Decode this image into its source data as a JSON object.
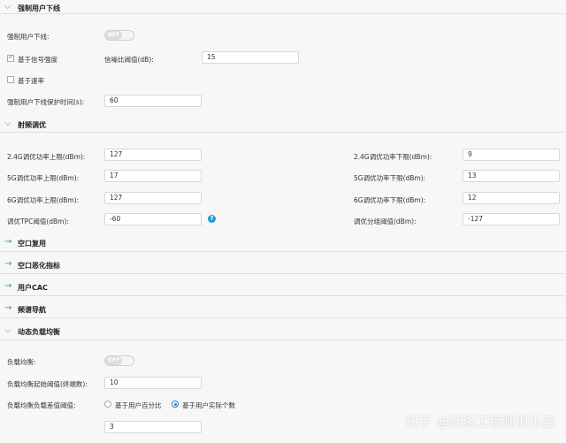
{
  "sections": {
    "forced_offline": "强制用户下线",
    "rf_tuning": "射频调优",
    "air_reuse": "空口复用",
    "air_degrade": "空口恶化指标",
    "user_cac": "用户CAC",
    "band_nav": "频谱导航",
    "dyn_lb": "动态负载均衡"
  },
  "forced_offline": {
    "enable_label": "强制用户下线:",
    "toggle_text": "OFF",
    "signal_check_label": "基于信号强度",
    "snr_label": "信噪比阈值(dB):",
    "snr_value": "15",
    "rate_check_label": "基于速率",
    "protect_label": "强制用户下线保护时间(s):",
    "protect_value": "60"
  },
  "rf": {
    "p24_up_label": "2.4G调优功率上限(dBm):",
    "p24_up_value": "127",
    "p24_down_label": "2.4G调优功率下限(dBm):",
    "p24_down_value": "9",
    "p5_up_label": "5G调优功率上限(dBm):",
    "p5_up_value": "17",
    "p5_down_label": "5G调优功率下限(dBm):",
    "p5_down_value": "13",
    "p6_up_label": "6G调优功率上限(dBm):",
    "p6_up_value": "127",
    "p6_down_label": "6G调优功率下限(dBm):",
    "p6_down_value": "12",
    "tpc_label": "调优TPC阈值(dBm):",
    "tpc_value": "-60",
    "seg_label": "调优分组阈值(dBm):",
    "seg_value": "-127"
  },
  "lb": {
    "enable_label": "负载均衡:",
    "toggle_text": "OFF",
    "start_label": "负载均衡起始阈值(终端数):",
    "start_value": "10",
    "diff_label": "负载均衡负载差值阈值:",
    "opt_percent": "基于用户百分比",
    "opt_count": "基于用户实际个数",
    "diff_value": "3"
  },
  "icons": {
    "section": "chevron-down-icon",
    "help": "help-icon"
  },
  "watermark": "知乎 @网络工程师俱乐部",
  "colors": {
    "accent_green": "#3aa655",
    "help_blue": "#1d9bd8"
  }
}
